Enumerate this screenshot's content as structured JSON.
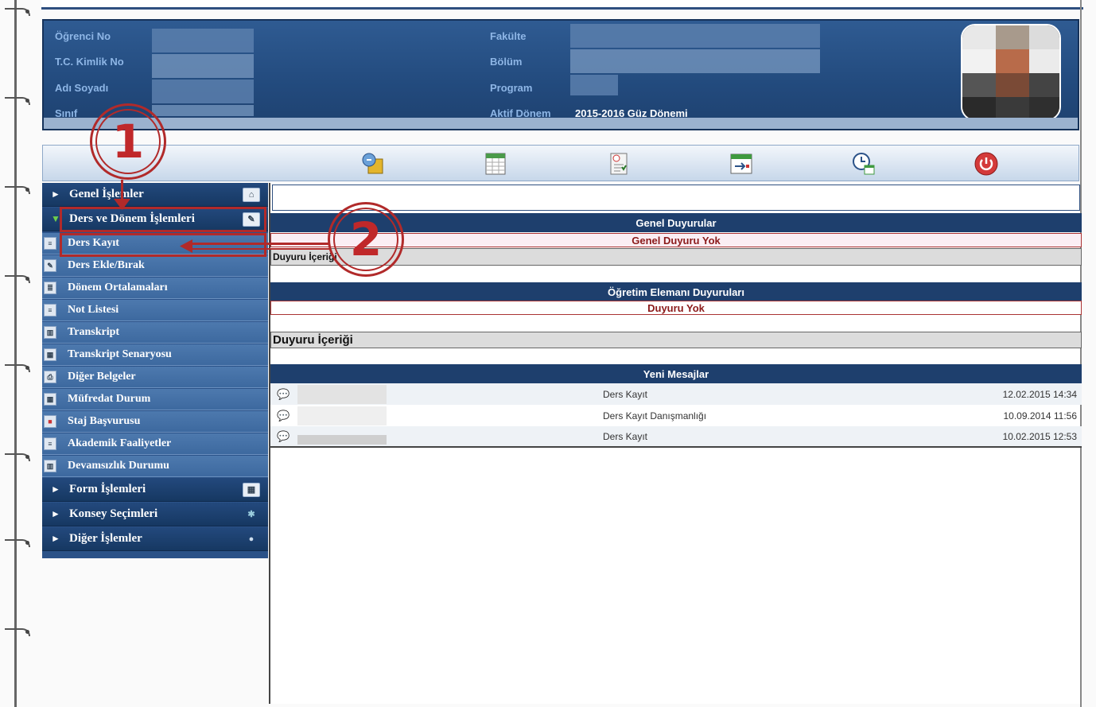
{
  "header": {
    "labels_left": [
      "Öğrenci No",
      "T.C. Kimlik No",
      "Adı Soyadı",
      "Sınıf"
    ],
    "labels_right": [
      "Fakülte",
      "Bölüm",
      "Program",
      "Aktif Dönem"
    ],
    "aktif_donem_value": "2015-2016 Güz Dönemi"
  },
  "toolbar": {
    "icons": [
      "profile-switch-icon",
      "calendar-sheet-icon",
      "exam-paper-icon",
      "calendar-arrow-icon",
      "clock-calendar-icon",
      "power-icon"
    ]
  },
  "sidebar": {
    "genel_islemler": "Genel İşlemler",
    "ders_donem": "Ders ve Dönem İşlemleri",
    "items": [
      "Ders Kayıt",
      "Ders Ekle/Bırak",
      "Dönem Ortalamaları",
      "Not Listesi",
      "Transkript",
      "Transkript Senaryosu",
      "Diğer Belgeler",
      "Müfredat Durum",
      "Staj Başvurusu",
      "Akademik Faaliyetler",
      "Devamsızlık Durumu"
    ],
    "form_islemleri": "Form İşlemleri",
    "konsey_secimleri": "Konsey Seçimleri",
    "diger_islemler": "Diğer İşlemler"
  },
  "content": {
    "genel_duyurular": "Genel Duyurular",
    "genel_duyuru_yok": "Genel Duyuru Yok",
    "duyuru_icerigi_1": "Duyuru İçeriği",
    "ogretim_elemani": "Öğretim Elemanı Duyuruları",
    "duyuru_yok": "Duyuru Yok",
    "duyuru_icerigi_2": "Duyuru İçeriği",
    "yeni_mesajlar": "Yeni Mesajlar",
    "messages": [
      {
        "subject": "Ders Kayıt",
        "date": "12.02.2015 14:34"
      },
      {
        "subject": "Ders Kayıt Danışmanlığı",
        "date": "10.09.2014 11:56"
      },
      {
        "subject": "Ders Kayıt",
        "date": "10.02.2015 12:53"
      }
    ]
  },
  "annotations": {
    "step1": "1",
    "step2": "2"
  },
  "colors": {
    "header_blue": "#224a7d",
    "sidebar_blue": "#3d699f",
    "annotation_red": "#b12a2a"
  }
}
